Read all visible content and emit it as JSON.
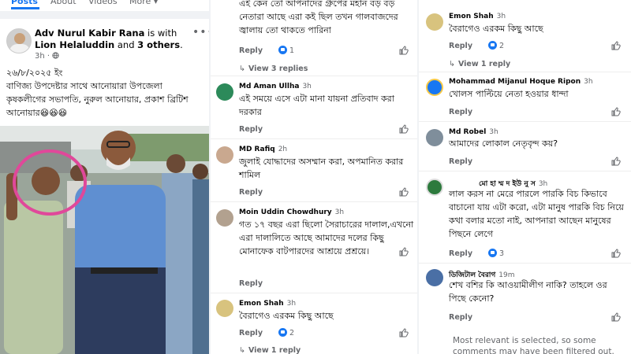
{
  "tabs": [
    {
      "label": "Posts"
    },
    {
      "label": "About"
    },
    {
      "label": "Videos"
    },
    {
      "label": "More ▾"
    }
  ],
  "post": {
    "author": "Adv Nurul Kabir Rana",
    "with_text": "is with",
    "tagged": "Lion Helaluddin",
    "and_text": "and",
    "others": "3 others",
    "time": "3h",
    "privacy_icon": "globe-icon",
    "text": "২৬/৮/২০২৫ ইং\nবাণিজ্য উপদেষ্টার সাথে আনোয়ারা উপজেলা কৃষকলীগের সভাপতি, নুরুল আনোয়ার, প্রকাশ ব্রিটিশ আনোয়ার😆😆😆"
  },
  "col2_comments": [
    {
      "name": "",
      "time": "",
      "text": "এই কেন তো আপনাদের গ্রুপের মহান বড় বড় নেতারা আছে এরা কই ছিল তখন গালবাজদের জ্বালায় তো থাকতে পারিনা",
      "reply": "Reply",
      "reactions": "1",
      "view_replies": "View 3 replies"
    },
    {
      "name": "Md Aman Ullha",
      "time": "3h",
      "text": "এই সময়ে এসে এটা মানা যায়না প্রতিবাদ করা দরকার",
      "reply": "Reply",
      "reactions": "",
      "view_replies": ""
    },
    {
      "name": "MD Rafiq",
      "time": "2h",
      "text": "জুলাই যোদ্ধাদের অসম্মান করা, অপমানিত করার শামিল",
      "reply": "Reply",
      "reactions": "",
      "view_replies": ""
    },
    {
      "name": "Moin Uddin Chowdhury",
      "time": "3h",
      "text": "গত ১৭ বছর এরা ছিলো সৈরাচারের দালাল,এখনো এরা দালালিতে আছে আমাদের দলের কিছু মোনাফেক বাটপারদের আশ্রয়ে প্রশ্রয়ে।",
      "reply": "Reply",
      "reactions": "",
      "view_replies": ""
    },
    {
      "name": "Emon Shah",
      "time": "3h",
      "text": "বৈরাগেও এরকম কিছু আছে",
      "reply": "Reply",
      "reactions": "2",
      "view_replies": "View 1 reply"
    }
  ],
  "col3_comments": [
    {
      "name": "Emon Shah",
      "time": "3h",
      "text": "বৈরাগেও এরকম কিছু আছে",
      "reply": "Reply",
      "reactions": "2",
      "view_replies": "View 1 reply"
    },
    {
      "name": "Mohammad Mijanul Hoque Ripon",
      "time": "3h",
      "text": "খোলস পাল্টিয়ে নেতা হওয়ার ধান্দা",
      "reply": "Reply",
      "reactions": "",
      "view_replies": ""
    },
    {
      "name": "Md Robel",
      "time": "3h",
      "text": "আমাদের লোকাল নেতৃবৃন্দ কয়?",
      "reply": "Reply",
      "reactions": "",
      "view_replies": ""
    },
    {
      "name": "মো হা ম্ম দ  ইউ নু স",
      "time": "3h",
      "text": "লাল করস না মেরে পারলে পারকি বিচ কিভাবে বাচানো যায় এটা করো, এটা মানুষ পারকি বিচ নিয়ে কথা বলার মতো নাই, আপনারা আছেন মানুষের পিছনে লেগে",
      "reply": "Reply",
      "reactions": "3",
      "view_replies": ""
    },
    {
      "name": "ডিজিটাল বৈরাগ",
      "time": "19m",
      "text": "শেখ বশির কি আওয়ামীলীগ নাকি? তাহলে ওর পিছে কেনো?",
      "reply": "Reply",
      "reactions": "",
      "view_replies": ""
    }
  ],
  "footer_note": "Most relevant is selected, so some comments may have been filtered out.",
  "colors": {
    "accent": "#1877f2",
    "muted": "#65676b",
    "text": "#050505",
    "highlight_circle": "#e0489a"
  }
}
